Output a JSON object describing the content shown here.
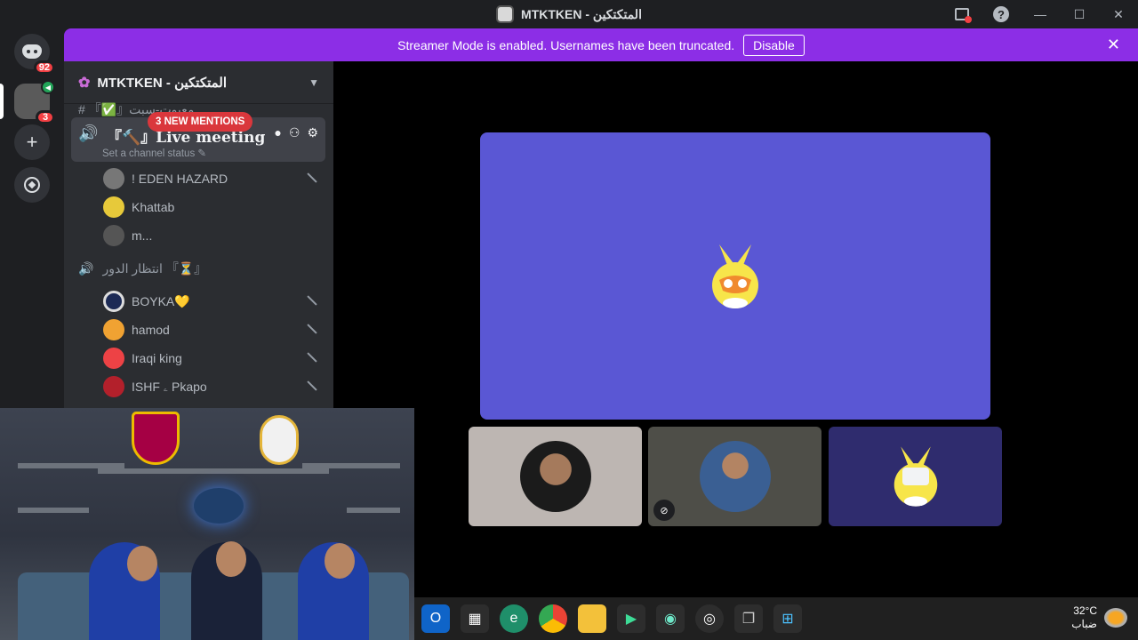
{
  "window": {
    "title": "MTKTKEN - المتكتكين",
    "controls": {
      "minimize": "—",
      "maximize": "☐",
      "close": "✕"
    }
  },
  "guilds": {
    "home_badge": "92",
    "server_badge": "3"
  },
  "banner": {
    "text": "Streamer Mode is enabled. Usernames have been truncated.",
    "button": "Disable",
    "close": "✕"
  },
  "sidebar": {
    "server_name": "MTKTKEN - المتكتكين",
    "cut_channel": "معبوت-سبت",
    "active_channel": {
      "name": "『🔨』Live meeting",
      "status": "Set a channel status ✎",
      "mentions": "3 NEW MENTIONS"
    },
    "members_1": [
      {
        "name": "! EDEN HAZARD",
        "muted": true
      },
      {
        "name": "Khattab",
        "muted": false
      },
      {
        "name": "m...",
        "muted": false
      }
    ],
    "channel_2": "انتظار الدور 『⏳』",
    "members_2": [
      {
        "name": "BOYKA💛",
        "muted": true
      },
      {
        "name": "hamod",
        "muted": true
      },
      {
        "name": "Iraqi king",
        "muted": true
      },
      {
        "name": "ISHF ۦ Pkapo",
        "muted": true
      }
    ]
  },
  "stage": {
    "tiles": [
      "participant-1",
      "participant-2",
      "participant-3"
    ]
  },
  "taskbar": {
    "temperature": "32°C",
    "weather": "ضباب"
  },
  "colors": {
    "banner": "#8c2ee6",
    "main_tile": "#5a57d4",
    "mention_badge": "#da373c"
  }
}
